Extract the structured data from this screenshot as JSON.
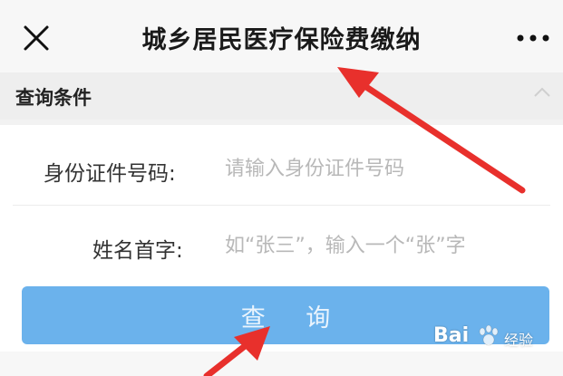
{
  "header": {
    "title": "城乡居民医疗保险费缴纳"
  },
  "section": {
    "title": "查询条件"
  },
  "form": {
    "id_label": "身份证件号码:",
    "id_placeholder": "请输入身份证件号码",
    "name_label": "姓名首字:",
    "name_placeholder": "如“张三”，输入一个“张”字",
    "submit_label": "查 询"
  },
  "watermark": {
    "brand": "Bai",
    "suffix": "经验"
  },
  "icons": {
    "close": "close-icon",
    "more": "more-icon",
    "collapse": "chevron-up-icon"
  },
  "colors": {
    "button": "#6bb2ec",
    "arrow": "#e8302c",
    "placeholder": "#b8b8b8"
  }
}
